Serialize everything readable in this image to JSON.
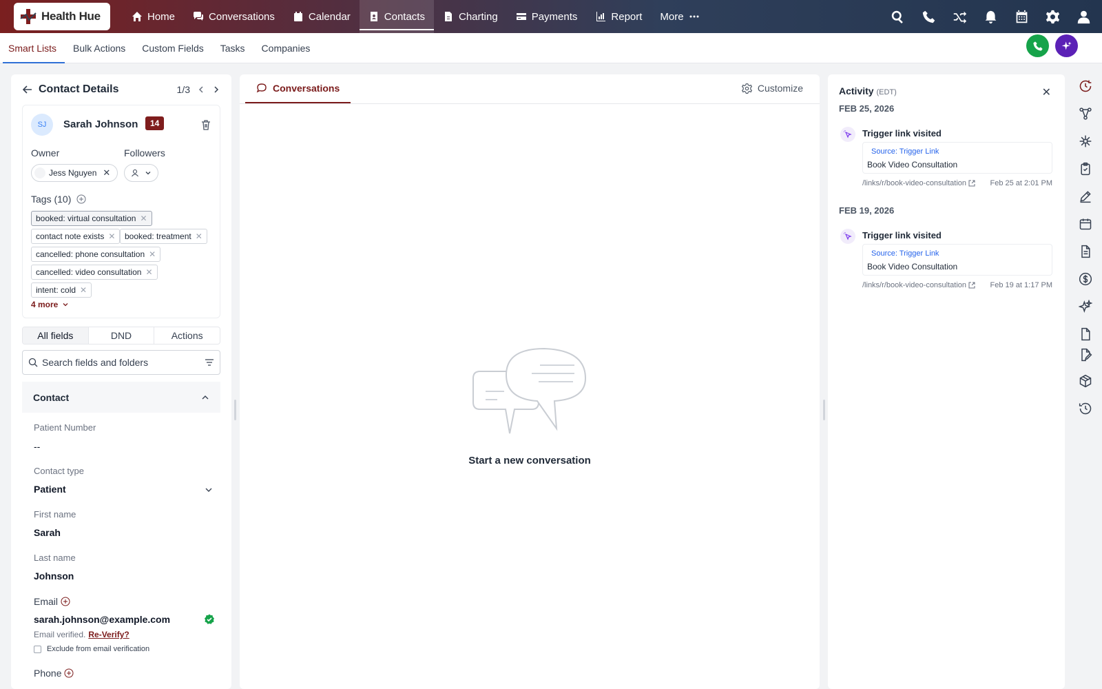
{
  "brand": {
    "name": "Health Hue"
  },
  "nav": {
    "items": [
      {
        "label": "Home",
        "icon": "home-icon"
      },
      {
        "label": "Conversations",
        "icon": "chat-icon"
      },
      {
        "label": "Calendar",
        "icon": "calendar-icon"
      },
      {
        "label": "Contacts",
        "icon": "contact-book-icon",
        "active": true
      },
      {
        "label": "Charting",
        "icon": "document-icon"
      },
      {
        "label": "Payments",
        "icon": "card-icon"
      },
      {
        "label": "Report",
        "icon": "report-icon"
      },
      {
        "label": "More",
        "icon": "more-dots-icon"
      }
    ],
    "right_icons": [
      "search-icon",
      "phone-icon",
      "shuffle-icon",
      "bell-icon",
      "calendar-grid-icon",
      "gear-icon",
      "user-icon"
    ]
  },
  "subnav": {
    "items": [
      "Smart Lists",
      "Bulk Actions",
      "Custom Fields",
      "Tasks",
      "Companies"
    ],
    "active": "Smart Lists"
  },
  "accent": {
    "brand": "#7a1a1a",
    "call_green": "#16a34a",
    "ai_purple": "#5b21b6"
  },
  "contact_panel": {
    "title": "Contact Details",
    "pager": "1/3",
    "contact": {
      "initials": "SJ",
      "name": "Sarah Johnson",
      "badge": "14"
    },
    "owner_label": "Owner",
    "owner_name": "Jess Nguyen",
    "followers_label": "Followers",
    "tags_label": "Tags (10)",
    "tags": [
      "booked: virtual consultation",
      "contact note exists",
      "booked: treatment",
      "cancelled: phone consultation",
      "cancelled: video consultation",
      "intent: cold"
    ],
    "more_tags": "4 more",
    "field_tabs": [
      "All fields",
      "DND",
      "Actions"
    ],
    "search_placeholder": "Search fields and folders",
    "section": "Contact",
    "fields": {
      "patient_number": {
        "label": "Patient Number",
        "value": "--"
      },
      "contact_type": {
        "label": "Contact type",
        "value": "Patient"
      },
      "first_name": {
        "label": "First name",
        "value": "Sarah"
      },
      "last_name": {
        "label": "Last name",
        "value": "Johnson"
      },
      "email": {
        "label": "Email",
        "value": "sarah.johnson@example.com",
        "verified_text": "Email verified.",
        "reverify": "Re-Verify?",
        "exclude": "Exclude from email verification"
      },
      "phone": {
        "label": "Phone"
      }
    }
  },
  "conversations": {
    "tab": "Conversations",
    "customize": "Customize",
    "empty": "Start a new conversation"
  },
  "activity": {
    "title": "Activity",
    "tz": "(EDT)",
    "groups": [
      {
        "date": "FEB 25, 2026",
        "event": "Trigger link visited",
        "source": "Source: Trigger Link",
        "name": "Book Video Consultation",
        "link": "/links/r/book-video-consultation",
        "time": "Feb 25 at 2:01 PM"
      },
      {
        "date": "FEB 19, 2026",
        "event": "Trigger link visited",
        "source": "Source: Trigger Link",
        "name": "Book Video Consultation",
        "link": "/links/r/book-video-consultation",
        "time": "Feb 19 at 1:17 PM"
      }
    ]
  },
  "right_rail": [
    "activity-clock-icon",
    "workflow-icon",
    "automation-icon",
    "clipboard-check-icon",
    "pen-icon",
    "calendar-icon",
    "document-icon",
    "dollar-icon",
    "sparkle-icon",
    "file-icon",
    "file-edit-icon",
    "package-icon",
    "history-icon"
  ]
}
